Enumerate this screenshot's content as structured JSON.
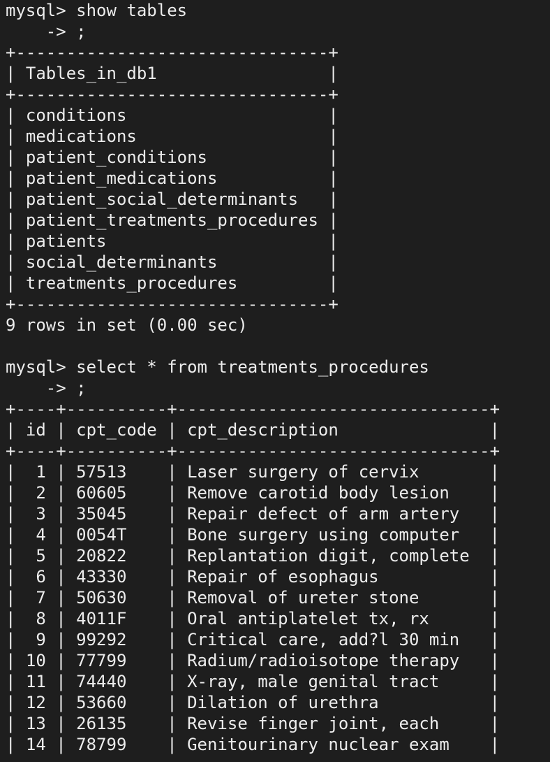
{
  "terminal": {
    "fg": "#ececec",
    "bg": "#1e1e1e",
    "lines": [
      "mysql> show tables",
      "    -> ;",
      "+-------------------------------+",
      "| Tables_in_db1                 |",
      "+-------------------------------+",
      "| conditions                    |",
      "| medications                   |",
      "| patient_conditions            |",
      "| patient_medications           |",
      "| patient_social_determinants   |",
      "| patient_treatments_procedures |",
      "| patients                      |",
      "| social_determinants           |",
      "| treatments_procedures         |",
      "+-------------------------------+",
      "9 rows in set (0.00 sec)",
      "",
      "mysql> select * from treatments_procedures",
      "    -> ;",
      "+----+----------+-------------------------------+",
      "| id | cpt_code | cpt_description               |",
      "+----+----------+-------------------------------+",
      "|  1 | 57513    | Laser surgery of cervix       |",
      "|  2 | 60605    | Remove carotid body lesion    |",
      "|  3 | 35045    | Repair defect of arm artery   |",
      "|  4 | 0054T    | Bone surgery using computer   |",
      "|  5 | 20822    | Replantation digit, complete  |",
      "|  6 | 43330    | Repair of esophagus           |",
      "|  7 | 50630    | Removal of ureter stone       |",
      "|  8 | 4011F    | Oral antiplatelet tx, rx      |",
      "|  9 | 99292    | Critical care, add?l 30 min   |",
      "| 10 | 77799    | Radium/radioisotope therapy   |",
      "| 11 | 74440    | X-ray, male genital tract     |",
      "| 12 | 53660    | Dilation of urethra           |",
      "| 13 | 26135    | Revise finger joint, each     |",
      "| 14 | 78799    | Genitourinary nuclear exam    |"
    ]
  }
}
